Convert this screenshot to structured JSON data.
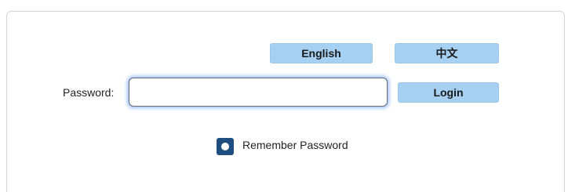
{
  "language_buttons": {
    "english_label": "English",
    "chinese_label": "中文"
  },
  "login_form": {
    "password_label": "Password:",
    "password_value": "",
    "login_label": "Login",
    "remember_label": "Remember Password",
    "remember_checked": true
  },
  "colors": {
    "button_bg": "#a6d0f2",
    "checkbox_bg": "#1f4f80",
    "input_focus_glow": "#78aaff",
    "panel_border": "#d4d4d4"
  }
}
